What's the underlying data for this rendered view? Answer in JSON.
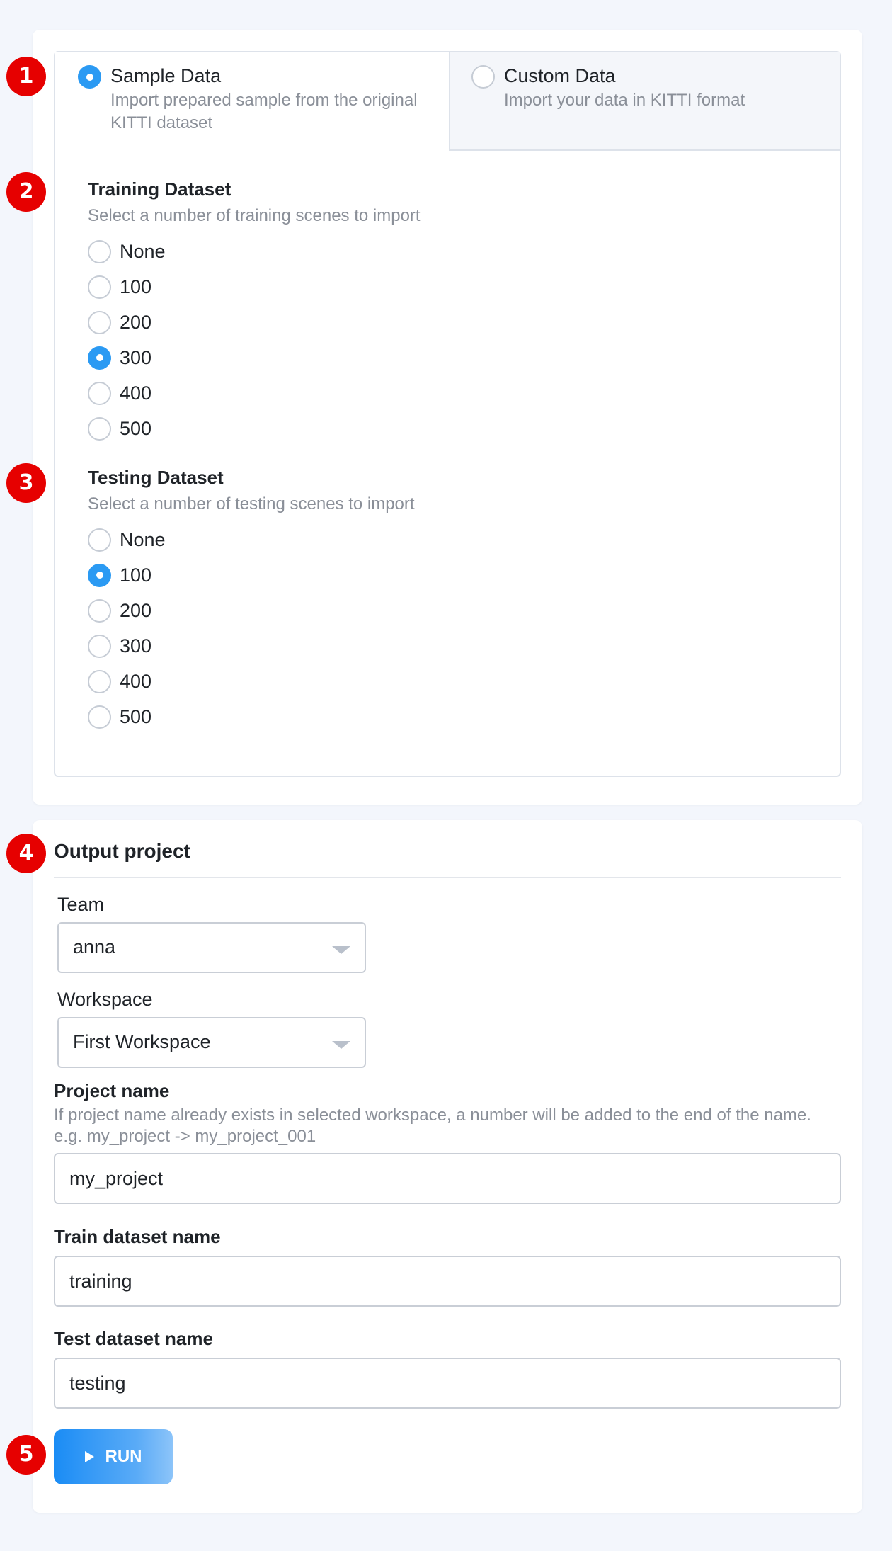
{
  "markers": [
    "1",
    "2",
    "3",
    "4",
    "5"
  ],
  "tabs": {
    "sample": {
      "title": "Sample Data",
      "description": "Import prepared sample from the original KITTI dataset",
      "selected": true
    },
    "custom": {
      "title": "Custom Data",
      "description": "Import your data in KITTI format",
      "selected": false
    }
  },
  "training": {
    "title": "Training Dataset",
    "description": "Select a number of training scenes to import",
    "options": [
      "None",
      "100",
      "200",
      "300",
      "400",
      "500"
    ],
    "selected": "300"
  },
  "testing": {
    "title": "Testing Dataset",
    "description": "Select a number of testing scenes to import",
    "options": [
      "None",
      "100",
      "200",
      "300",
      "400",
      "500"
    ],
    "selected": "100"
  },
  "output": {
    "title": "Output project",
    "team_label": "Team",
    "team_value": "anna",
    "workspace_label": "Workspace",
    "workspace_value": "First Workspace",
    "project_label": "Project name",
    "project_hint": "If project name already exists in selected workspace, a number will be added to the end of the name. e.g. my_project -> my_project_001",
    "project_value": "my_project",
    "train_label": "Train dataset name",
    "train_value": "training",
    "test_label": "Test dataset name",
    "test_value": "testing",
    "run_label": "RUN"
  },
  "colors": {
    "accent": "#2b9af3",
    "marker": "#e60000",
    "background": "#f3f6fc"
  }
}
